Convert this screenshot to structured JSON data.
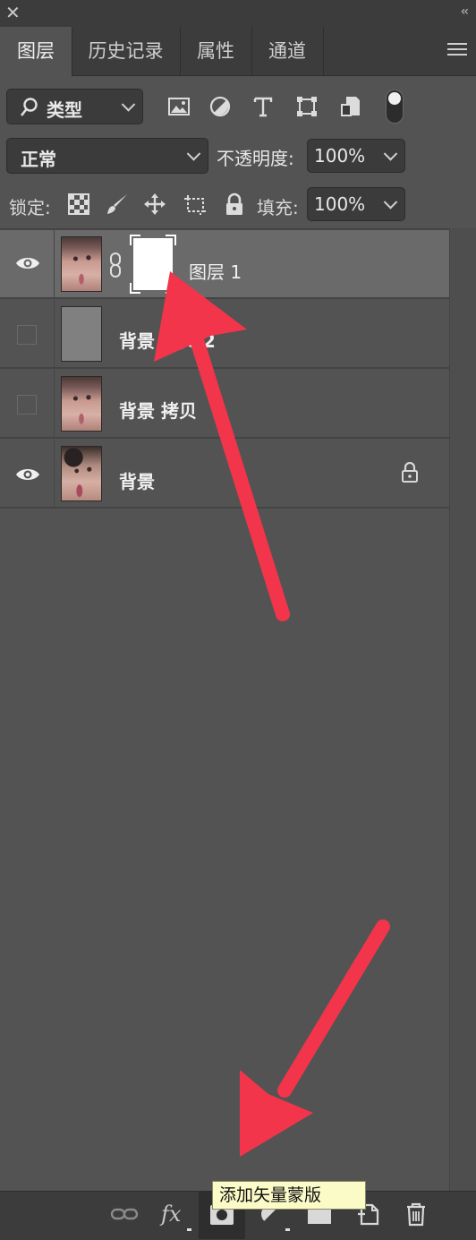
{
  "tabs": [
    {
      "label": "图层"
    },
    {
      "label": "历史记录"
    },
    {
      "label": "属性"
    },
    {
      "label": "通道"
    }
  ],
  "filter": {
    "kind_label": "类型"
  },
  "blend": {
    "mode": "正常",
    "opacity_label": "不透明度:",
    "opacity_value": "100%"
  },
  "lock": {
    "label": "锁定:",
    "fill_label": "填充:",
    "fill_value": "100%"
  },
  "layers": [
    {
      "name": "图层 1",
      "visible": true,
      "selected": true,
      "has_mask": true
    },
    {
      "name": "背景 拷贝 2",
      "visible": false,
      "selected": false
    },
    {
      "name": "背景 拷贝",
      "visible": false,
      "selected": false
    },
    {
      "name": "背景",
      "visible": true,
      "selected": false,
      "locked": true
    }
  ],
  "tooltip": {
    "text": "添加矢量蒙版"
  },
  "colors": {
    "panel": "#535353",
    "toolbar": "#3c3c3c",
    "selected_row": "#6a6a6a",
    "arrow": "#f2354a",
    "tooltip_bg": "#fbfbc8"
  },
  "bottom_icons": [
    "link-layers-icon",
    "fx-icon",
    "add-mask-icon",
    "adjustment-layer-icon",
    "group-folder-icon",
    "new-layer-icon",
    "trash-icon"
  ]
}
